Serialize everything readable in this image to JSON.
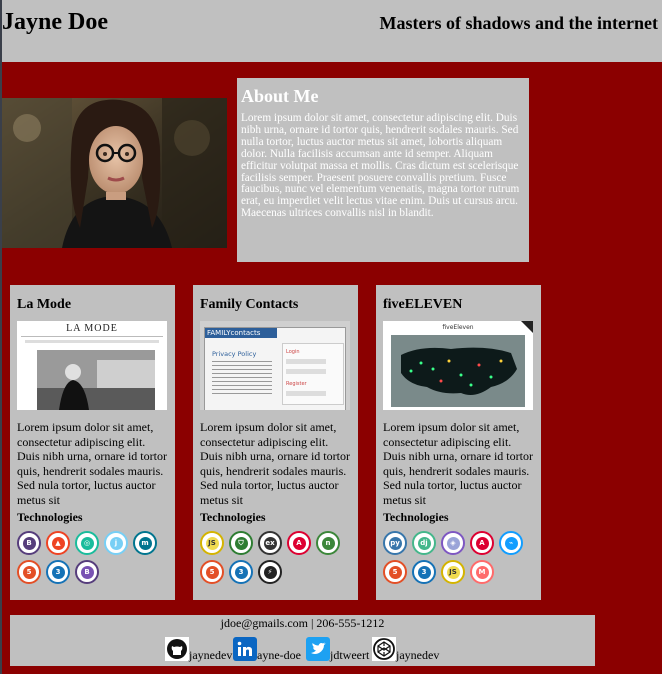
{
  "header": {
    "name": "Jayne Doe",
    "tagline": "Masters of shadows and the internet"
  },
  "about": {
    "title": "About Me",
    "text": "Lorem ipsum dolor sit amet, consectetur adipiscing elit. Duis nibh urna, ornare id tortor quis, hendrerit sodales mauris. Sed nulla tortor, luctus auctor metus sit amet, lobortis aliquam dolor. Nulla facilisis accumsan ante id semper. Aliquam efficitur volutpat massa et mollis. Cras dictum est scelerisque facilisis semper. Praesent posuere convallis pretium. Fusce faucibus, nunc vel elementum venenatis, magna tortor rutrum erat, eu imperdiet velit lectus vitae enim. Duis ut cursus arcu. Maecenas ultrices convallis nisl in blandit."
  },
  "projects": [
    {
      "title": "La Mode",
      "screenshot_heading": "LA MODE",
      "description": "Lorem ipsum dolor sit amet, consectetur adipiscing elit. Duis nibh urna, ornare id tortor quis, hendrerit sodales mauris. Sed nula tortor, luctus auctor metus sit",
      "tech_label": "Technologies"
    },
    {
      "title": "Family Contacts",
      "screenshot_heading": "FAMILYcontacts",
      "screenshot_sub": "Privacy Policy",
      "screenshot_sub2": "Login",
      "screenshot_sub3": "Register",
      "description": "Lorem ipsum dolor sit amet, consectetur adipiscing elit. Duis nibh urna, ornare id tortor quis, hendrerit sodales mauris. Sed nula tortor, luctus auctor metus sit",
      "tech_label": "Technologies"
    },
    {
      "title": "fiveELEVEN",
      "screenshot_heading": "fiveEleven",
      "description": "Lorem ipsum dolor sit amet, consectetur adipiscing elit. Duis nibh urna, ornare id tortor quis, hendrerit sodales mauris. Sed nula tortor, luctus auctor metus sit",
      "tech_label": "Technologies"
    }
  ],
  "tech_icons": {
    "card1": [
      {
        "name": "bootstrap-icon",
        "color": "#563d7c"
      },
      {
        "name": "codeigniter-icon",
        "color": "#ee4323"
      },
      {
        "name": "npm-icon",
        "color": "#1abc9c"
      },
      {
        "name": "jquery-icon",
        "color": "#78cff5"
      },
      {
        "name": "mysql-icon",
        "color": "#00758f"
      },
      {
        "name": "html5-icon",
        "color": "#e34f26"
      },
      {
        "name": "css3-icon",
        "color": "#1572b6"
      },
      {
        "name": "bootstrap-b-icon",
        "color": "#563d7c"
      }
    ],
    "card2": [
      {
        "name": "javascript-icon",
        "color": "#f0db4f"
      },
      {
        "name": "shield-icon",
        "color": "#2e7d32"
      },
      {
        "name": "express-icon",
        "color": "#333333"
      },
      {
        "name": "angular-icon",
        "color": "#dd0031"
      },
      {
        "name": "nodejs-icon",
        "color": "#3c873a"
      },
      {
        "name": "html5-icon",
        "color": "#e34f26"
      },
      {
        "name": "css3-icon",
        "color": "#1572b6"
      },
      {
        "name": "bolt-icon",
        "color": "#222222"
      }
    ],
    "card3": [
      {
        "name": "python-icon",
        "color": "#3776ab"
      },
      {
        "name": "django-icon",
        "color": "#44b78b"
      },
      {
        "name": "graphql-icon",
        "color": "#7e57c2"
      },
      {
        "name": "angular-icon",
        "color": "#dd0031"
      },
      {
        "name": "plotly-icon",
        "color": "#119dff"
      },
      {
        "name": "html5-icon",
        "color": "#e34f26"
      },
      {
        "name": "css3-icon",
        "color": "#1572b6"
      },
      {
        "name": "javascript-icon",
        "color": "#f0db4f"
      },
      {
        "name": "material-icon",
        "color": "#ff6b6b"
      }
    ]
  },
  "footer": {
    "contact": "jdoe@gmails.com | 206-555-1212",
    "socials": [
      {
        "icon": "github-icon",
        "handle": "jaynedev"
      },
      {
        "icon": "linkedin-icon",
        "handle": "ayne-doe"
      },
      {
        "icon": "twitter-icon",
        "handle": "jdtweert"
      },
      {
        "icon": "codepen-icon",
        "handle": "jaynedev"
      }
    ]
  },
  "colors": {
    "page_background": "#8b0000",
    "panel": "#c0c0c0"
  }
}
